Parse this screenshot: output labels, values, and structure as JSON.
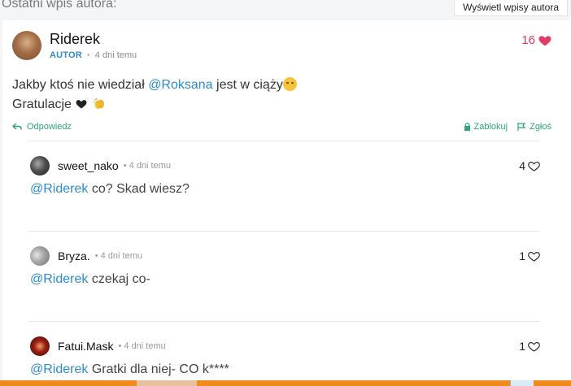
{
  "header": {
    "label": "Ostatni wpis autora:",
    "button": "Wyświetl wpisy autora"
  },
  "post": {
    "author": "Riderek",
    "badge": "AUTOR",
    "time": "4 dni temu",
    "likes": "16",
    "line1_prefix": "Jakby ktoś nie wiedział ",
    "mention": "@Roksana",
    "line1_suffix": " jest w ciąży",
    "line2": "Gratulacje",
    "reply_label": "Odpowiedz",
    "block_label": "Zablokuj",
    "report_label": "Zgłoś"
  },
  "replies": [
    {
      "name": "sweet_nako",
      "time": "4 dni temu",
      "likes": "4",
      "mention": "@Riderek",
      "text": " co? Skad wiesz?"
    },
    {
      "name": "Bryza.",
      "time": "4 dni temu",
      "likes": "1",
      "mention": "@Riderek",
      "text": " czekaj co-"
    },
    {
      "name": "Fatui.Mask",
      "time": "4 dni temu",
      "likes": "1",
      "mention": "@Riderek",
      "text": " Gratki dla niej- CO k****"
    }
  ],
  "colors": {
    "accent": "#2d8ccf",
    "green": "#2aa87b",
    "like": "#e03a66"
  },
  "icons": {
    "like": "heart-icon",
    "reply": "reply-arrow-icon",
    "block": "lock-icon",
    "report": "flag-icon"
  }
}
